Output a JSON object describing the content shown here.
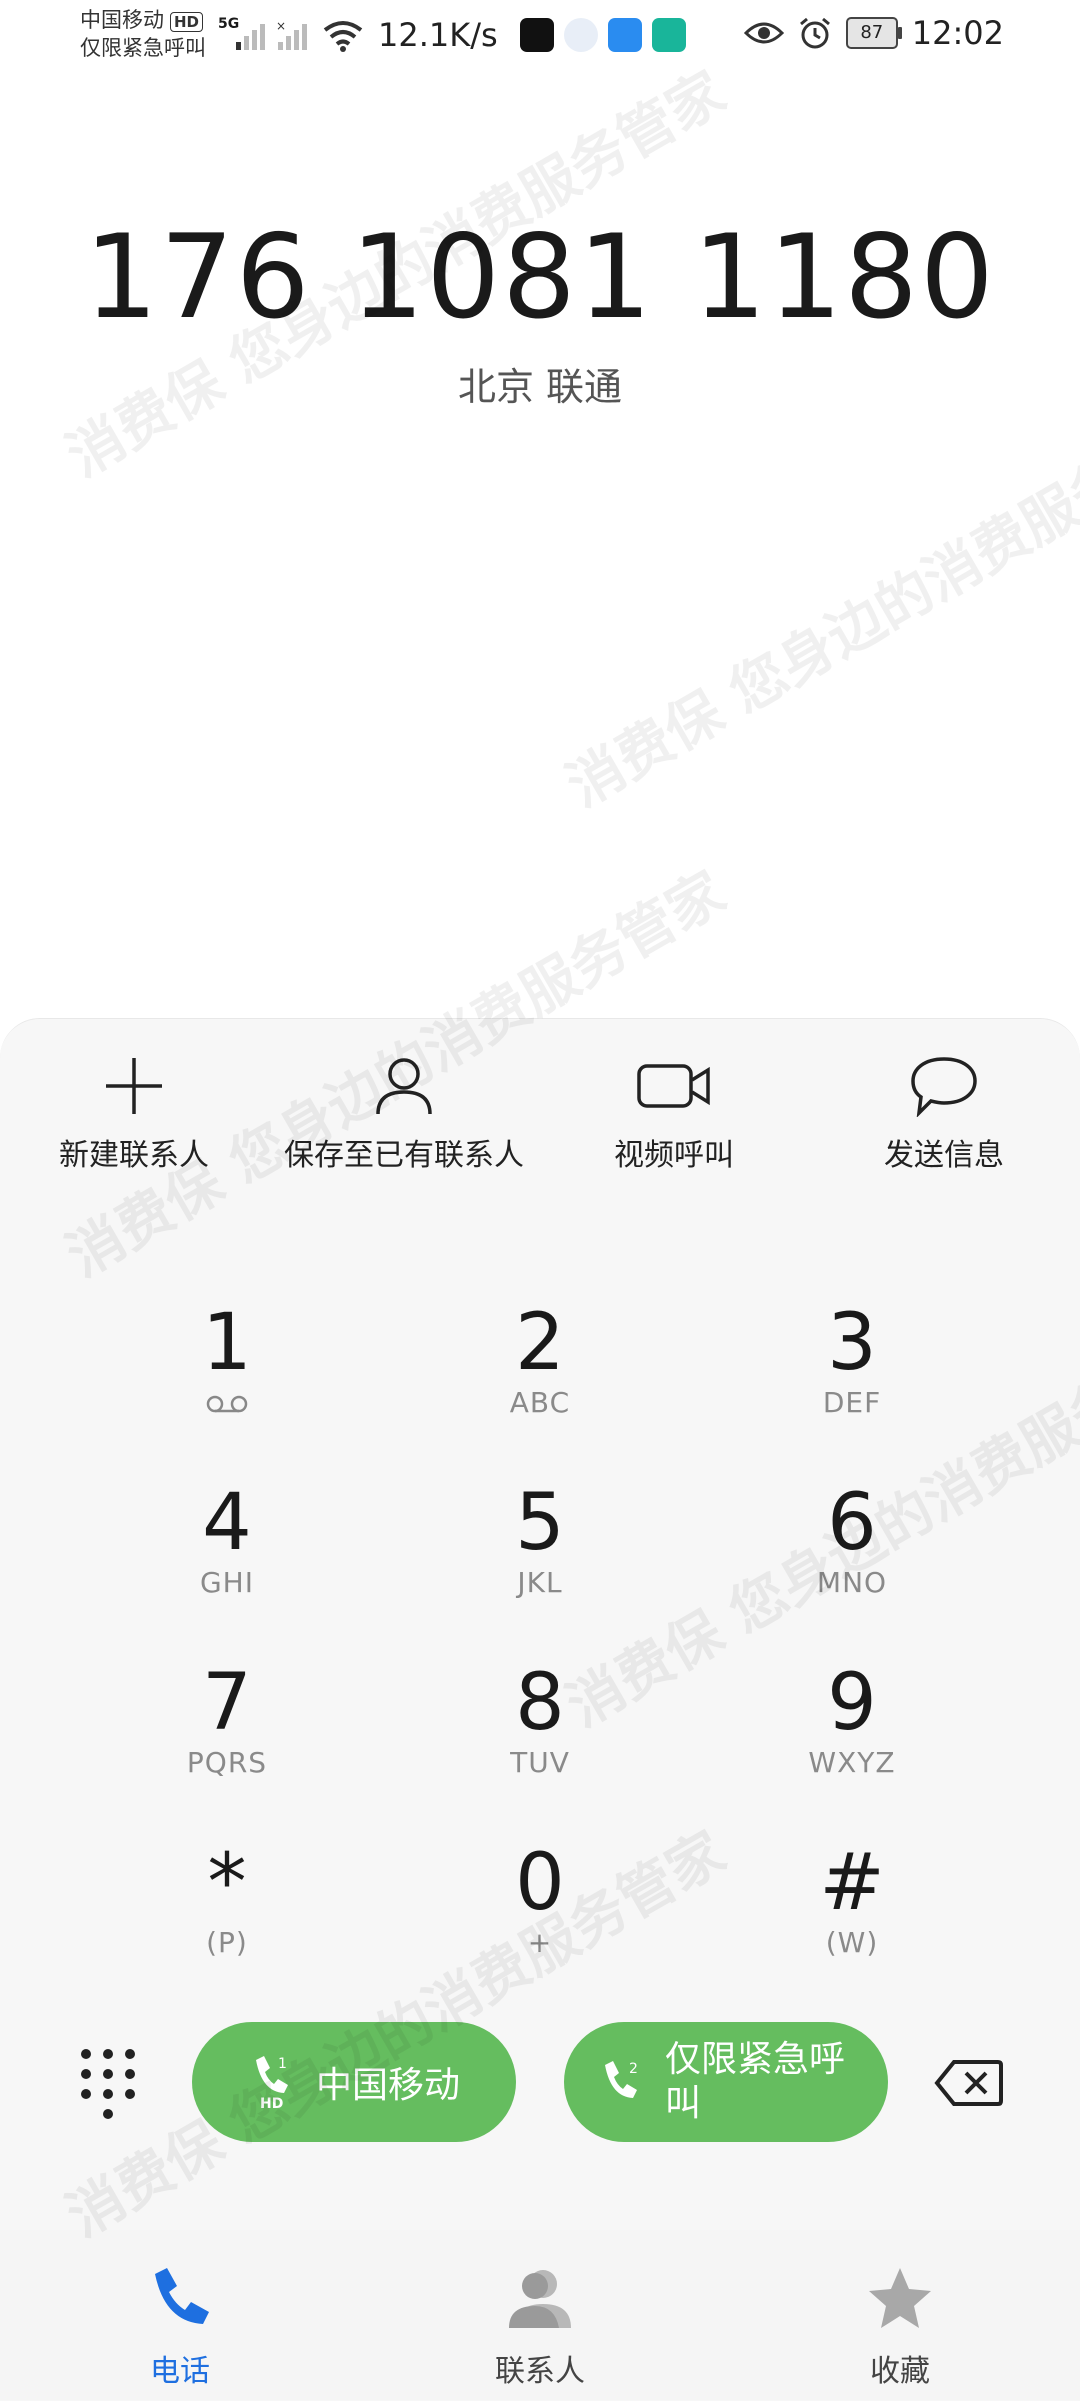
{
  "status_bar": {
    "carrier_line1": "中国移动",
    "hd_badge": "HD",
    "carrier_line2": "仅限紧急呼叫",
    "network": "5G",
    "net_speed": "12.1K/s",
    "battery": "87",
    "time": "12:02"
  },
  "dialer": {
    "number": "176 1081 1180",
    "location": "北京 联通"
  },
  "actions": [
    {
      "label": "新建联系人",
      "icon": "plus-icon"
    },
    {
      "label": "保存至已有联系人",
      "icon": "person-icon"
    },
    {
      "label": "视频呼叫",
      "icon": "video-camera-icon"
    },
    {
      "label": "发送信息",
      "icon": "message-bubble-icon"
    }
  ],
  "keypad": [
    {
      "digit": "1",
      "sub": ""
    },
    {
      "digit": "2",
      "sub": "ABC"
    },
    {
      "digit": "3",
      "sub": "DEF"
    },
    {
      "digit": "4",
      "sub": "GHI"
    },
    {
      "digit": "5",
      "sub": "JKL"
    },
    {
      "digit": "6",
      "sub": "MNO"
    },
    {
      "digit": "7",
      "sub": "PQRS"
    },
    {
      "digit": "8",
      "sub": "TUV"
    },
    {
      "digit": "9",
      "sub": "WXYZ"
    },
    {
      "digit": "*",
      "sub": "(P)"
    },
    {
      "digit": "0",
      "sub": "+"
    },
    {
      "digit": "#",
      "sub": "(W)"
    }
  ],
  "call_buttons": {
    "sim1_label": "中国移动",
    "sim1_num": "1",
    "sim1_hd": "HD",
    "sim2_label": "仅限紧急呼叫",
    "sim2_num": "2"
  },
  "tabs": {
    "phone": "电话",
    "contacts": "联系人",
    "favorites": "收藏"
  },
  "watermark_text": "消费保 您身边的消费服务管家",
  "colors": {
    "call_green": "#65bd5f",
    "active_blue": "#1e6fe0"
  }
}
